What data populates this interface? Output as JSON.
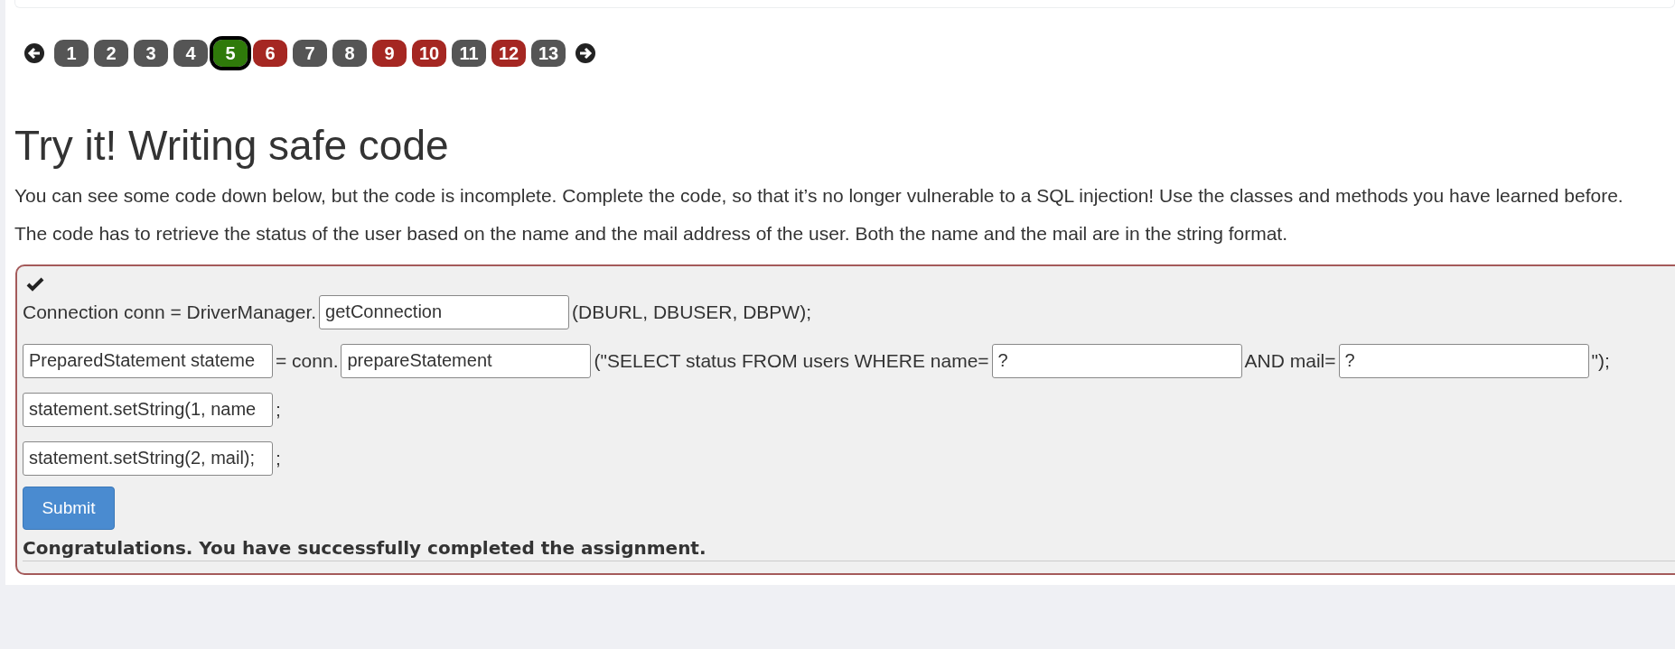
{
  "pagination": {
    "pages": [
      {
        "label": "1",
        "color": "#555555",
        "selected": false
      },
      {
        "label": "2",
        "color": "#555555",
        "selected": false
      },
      {
        "label": "3",
        "color": "#555555",
        "selected": false
      },
      {
        "label": "4",
        "color": "#555555",
        "selected": false
      },
      {
        "label": "5",
        "color": "#2f7a0a",
        "selected": true
      },
      {
        "label": "6",
        "color": "#a52722",
        "selected": false
      },
      {
        "label": "7",
        "color": "#555555",
        "selected": false
      },
      {
        "label": "8",
        "color": "#555555",
        "selected": false
      },
      {
        "label": "9",
        "color": "#a52722",
        "selected": false
      },
      {
        "label": "10",
        "color": "#a52722",
        "selected": false
      },
      {
        "label": "11",
        "color": "#555555",
        "selected": false
      },
      {
        "label": "12",
        "color": "#a52722",
        "selected": false
      },
      {
        "label": "13",
        "color": "#555555",
        "selected": false
      }
    ]
  },
  "title": "Try it! Writing safe code",
  "paragraphs": [
    "You can see some code down below, but the code is incomplete. Complete the code, so that it’s no longer vulnerable to a SQL injection! Use the classes and methods you have learned before.",
    "The code has to retrieve the status of the user based on the name and the mail address of the user. Both the name and the mail are in the string format."
  ],
  "assignment": {
    "solved": true,
    "lines": [
      [
        {
          "kind": "text",
          "text": "Connection conn = DriverManager."
        },
        {
          "kind": "input",
          "value": "getConnection"
        },
        {
          "kind": "text",
          "text": "(DBURL, DBUSER, DBPW);"
        }
      ],
      [
        {
          "kind": "input",
          "value": "PreparedStatement stateme"
        },
        {
          "kind": "text",
          "text": "= conn."
        },
        {
          "kind": "input",
          "value": "prepareStatement"
        },
        {
          "kind": "text",
          "text": "(\"SELECT status FROM users WHERE name="
        },
        {
          "kind": "input",
          "value": "?"
        },
        {
          "kind": "text",
          "text": "AND mail="
        },
        {
          "kind": "input",
          "value": "?"
        },
        {
          "kind": "text",
          "text": "\");"
        }
      ],
      [
        {
          "kind": "input",
          "value": "statement.setString(1, name"
        },
        {
          "kind": "text",
          "text": ";"
        }
      ],
      [
        {
          "kind": "input",
          "value": "statement.setString(2, mail);"
        },
        {
          "kind": "text",
          "text": ";"
        }
      ]
    ],
    "submit": "Submit",
    "feedback": "Congratulations. You have successfully completed the assignment."
  }
}
